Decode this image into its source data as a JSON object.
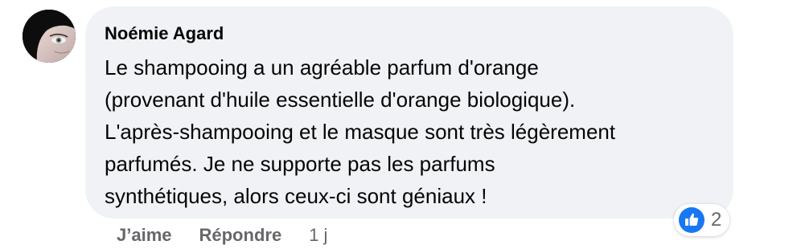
{
  "comment": {
    "author": "Noémie Agard",
    "text": "Le shampooing a un agréable parfum d'orange\n(provenant d'huile essentielle d'orange biologique).\nL'après-shampooing et le masque sont très légèrement\nparfumés. Je ne supporte pas les parfums\nsynthétiques, alors ceux-ci sont géniaux !",
    "reactions": {
      "icon": "like-icon",
      "count": "2"
    },
    "actions": {
      "like_label": "J’aime",
      "reply_label": "Répondre",
      "timestamp": "1 j"
    }
  },
  "colors": {
    "bubble_background": "#f0f2f5",
    "text_primary": "#050505",
    "text_secondary": "#65676b",
    "like_blue": "#1877f2"
  }
}
